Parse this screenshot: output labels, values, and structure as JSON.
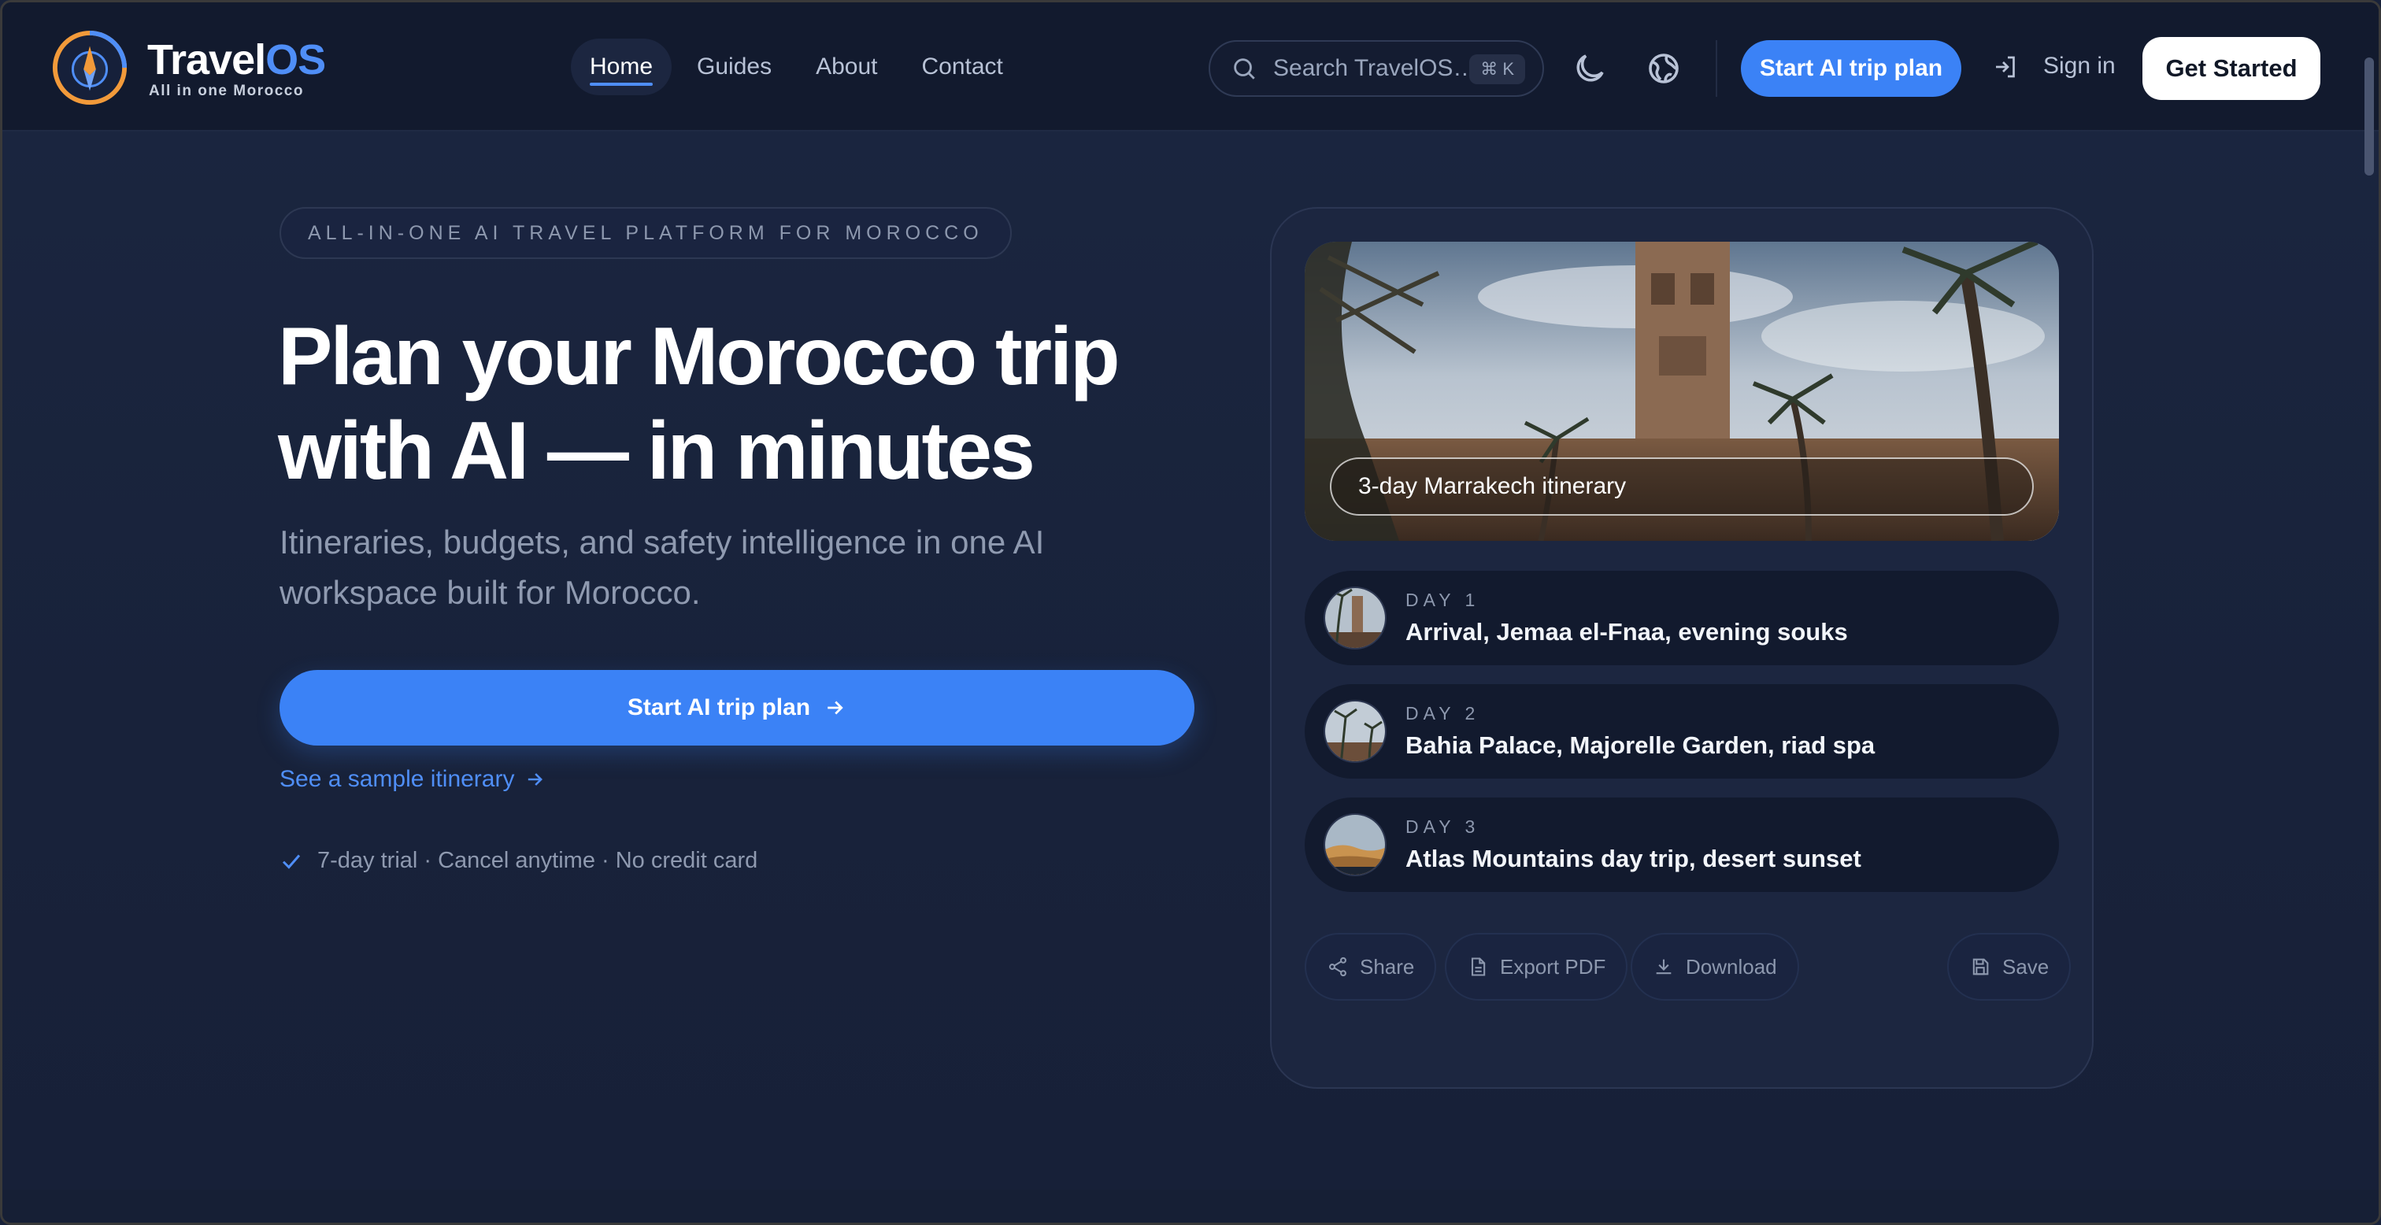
{
  "brand": {
    "name_main": "Travel",
    "name_accent": "OS",
    "tagline": "All in one Morocco"
  },
  "nav": {
    "links": [
      "Home",
      "Guides",
      "About",
      "Contact"
    ],
    "active": "Home",
    "search_placeholder": "Search TravelOS…",
    "search_shortcut": "⌘ K",
    "cta_label": "Start AI trip plan",
    "signin_label": "Sign in",
    "get_started_label": "Get Started"
  },
  "hero": {
    "eyebrow": "ALL-IN-ONE AI TRAVEL PLATFORM FOR MOROCCO",
    "title_line1": "Plan your Morocco trip",
    "title_line2": "with AI — in minutes",
    "subtitle_line1": "Itineraries, budgets, and safety intelligence in one AI",
    "subtitle_line2": "workspace built for Morocco.",
    "primary_cta": "Start AI trip plan",
    "secondary_link": "See a sample itinerary",
    "trial_note": "7-day trial · Cancel anytime · No credit card"
  },
  "itinerary": {
    "title": "3-day Marrakech itinerary",
    "days": [
      {
        "label": "DAY 1",
        "title": "Arrival, Jemaa el-Fnaa, evening souks"
      },
      {
        "label": "DAY 2",
        "title": "Bahia Palace, Majorelle Garden, riad spa"
      },
      {
        "label": "DAY 3",
        "title": "Atlas Mountains day trip, desert sunset"
      }
    ],
    "actions": {
      "share": "Share",
      "export_pdf": "Export PDF",
      "download": "Download",
      "save": "Save"
    }
  },
  "colors": {
    "accent": "#3b82f6",
    "background": "#18223a",
    "nav_bg": "#121a2e",
    "brand_orange": "#f29a3a"
  },
  "icons": {
    "search": "search-icon",
    "theme": "moon-icon",
    "globe": "globe-icon",
    "signin": "sign-in-icon",
    "arrow": "arrow-right-icon",
    "check": "check-icon",
    "share": "share-icon",
    "pdf": "file-icon",
    "download": "download-icon",
    "save": "save-icon"
  }
}
